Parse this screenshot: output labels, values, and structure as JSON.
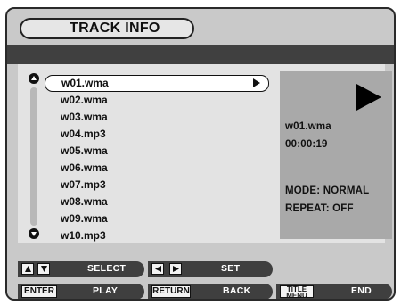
{
  "title": "TRACK INFO",
  "files": [
    {
      "name": "w01.wma"
    },
    {
      "name": "w02.wma"
    },
    {
      "name": "w03.wma"
    },
    {
      "name": "w04.mp3"
    },
    {
      "name": "w05.wma"
    },
    {
      "name": "w06.wma"
    },
    {
      "name": "w07.mp3"
    },
    {
      "name": "w08.wma"
    },
    {
      "name": "w09.wma"
    },
    {
      "name": "w10.mp3"
    }
  ],
  "info": {
    "filename": "w01.wma",
    "time": "00:00:19",
    "mode": "MODE:  NORMAL",
    "repeat": "REPEAT:  OFF"
  },
  "controls": {
    "select": "SELECT",
    "set": "SET",
    "enter_key": "ENTER",
    "play": "PLAY",
    "return_key": "RETURN",
    "back": "BACK",
    "title_menu_line1": "TITLE",
    "title_menu_line2": "MENU",
    "end": "END"
  },
  "icons": {
    "up": "triangle-up-icon",
    "down": "triangle-down-icon",
    "left": "triangle-left-icon",
    "right": "triangle-right-icon",
    "play": "play-icon"
  }
}
